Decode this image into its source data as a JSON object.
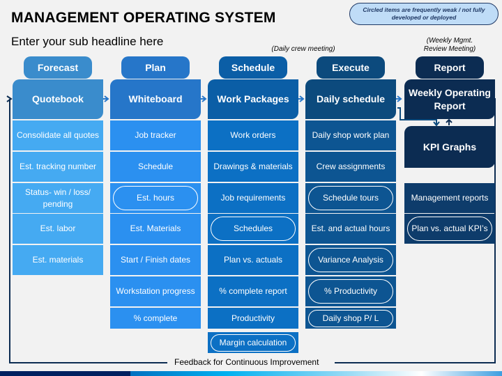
{
  "title": "MANAGEMENT OPERATING SYSTEM",
  "subtitle": "Enter your sub headline here",
  "note": "Circled items are frequently weak / not fully developed or deployed",
  "annotations": {
    "schedule": "(Daily crew meeting)",
    "report_line1": "(Weekly Mgmt.",
    "report_line2": "Review Meeting)"
  },
  "feedback_label": "Feedback for Continuous Improvement",
  "columns": [
    {
      "phase": "Forecast",
      "header": "Quotebook",
      "items": [
        {
          "text": "Consolidate all quotes",
          "circled": false
        },
        {
          "text": "Est. tracking number",
          "circled": false
        },
        {
          "text": "Status- win / loss/ pending",
          "circled": false
        },
        {
          "text": "Est. labor",
          "circled": false
        },
        {
          "text": "Est. materials",
          "circled": false
        }
      ]
    },
    {
      "phase": "Plan",
      "header": "Whiteboard",
      "items": [
        {
          "text": "Job tracker",
          "circled": false
        },
        {
          "text": "Schedule",
          "circled": false
        },
        {
          "text": "Est. hours",
          "circled": true
        },
        {
          "text": "Est. Materials",
          "circled": false
        },
        {
          "text": "Start / Finish dates",
          "circled": false
        },
        {
          "text": "Workstation progress",
          "circled": false
        },
        {
          "text": "% complete",
          "circled": false
        }
      ]
    },
    {
      "phase": "Schedule",
      "header": "Work Packages",
      "items": [
        {
          "text": "Work orders",
          "circled": false
        },
        {
          "text": "Drawings & materials",
          "circled": false
        },
        {
          "text": "Job requirements",
          "circled": false
        },
        {
          "text": "Schedules",
          "circled": true
        },
        {
          "text": "Plan vs. actuals",
          "circled": false
        },
        {
          "text": "% complete report",
          "circled": false
        },
        {
          "text": "Productivity",
          "circled": false
        },
        {
          "text": "Margin calculation",
          "circled": true
        }
      ]
    },
    {
      "phase": "Execute",
      "header": "Daily schedule",
      "items": [
        {
          "text": "Daily shop work plan",
          "circled": false
        },
        {
          "text": "Crew assignments",
          "circled": false
        },
        {
          "text": "Schedule tours",
          "circled": true
        },
        {
          "text": "Est. and actual hours",
          "circled": false
        },
        {
          "text": "Variance Analysis",
          "circled": true
        },
        {
          "text": "% Productivity",
          "circled": true
        },
        {
          "text": "Daily shop P/ L",
          "circled": true
        }
      ]
    },
    {
      "phase": "Report",
      "header": "Weekly Operating Report",
      "sub_header": "KPI Graphs",
      "items": [
        {
          "text": "Management reports",
          "circled": false
        },
        {
          "text": "Plan vs. actual KPI’s",
          "circled": true
        }
      ]
    }
  ]
}
